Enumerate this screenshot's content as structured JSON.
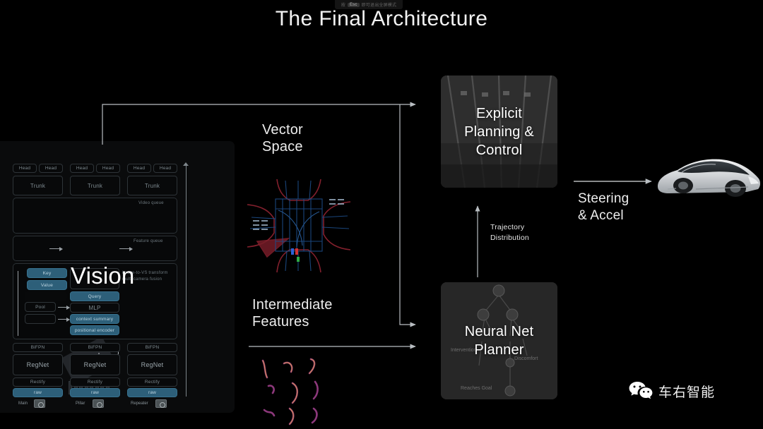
{
  "slide": {
    "title": "The Final Architecture",
    "background_color": "#000000"
  },
  "fullscreen_hint": {
    "prefix": "按",
    "key": "Esc",
    "suffix": "即可退出全屏模式"
  },
  "vision_panel": {
    "overlay_word": "Vision",
    "head_label": "Head",
    "trunk_label": "Trunk",
    "heads": [
      "Head",
      "Head",
      "Head",
      "Head",
      "Head",
      "Head"
    ],
    "trunks": [
      "Trunk",
      "Trunk",
      "Trunk"
    ],
    "video_queue_label": "Video queue",
    "feature_queue_label": "Feature queue",
    "attention": {
      "key": "Key",
      "value": "Value",
      "query": "Query",
      "mlp": "MLP",
      "pool": "Pool",
      "context_summary": "context summary",
      "positional_encoder": "positional encoder",
      "note_line1": "image-to-VS transform",
      "note_line2": "multi-camera fusion"
    },
    "backbone_rows": {
      "bifpn": [
        "BiFPN",
        "BiFPN",
        "BiFPN"
      ],
      "regnet": [
        "RegNet",
        "RegNet",
        "RegNet"
      ],
      "rectify": [
        "Rectify",
        "Rectify",
        "Rectify"
      ],
      "raw": [
        "raw",
        "raw",
        "raw"
      ]
    },
    "cameras": [
      "Main",
      "Pillar",
      "Repeater"
    ],
    "colors": {
      "blue_block": "#2d5f79",
      "panel_bg": "#0a0b0c",
      "border": "#2e3438"
    }
  },
  "outputs": {
    "vector_space_label": "Vector\nSpace",
    "vector_space_line1": "Vector",
    "vector_space_line2": "Space",
    "intermediate_features_line1": "Intermediate",
    "intermediate_features_line2": "Features"
  },
  "stages": {
    "explicit": {
      "line1": "Explicit",
      "line2": "Planning &",
      "line3": "Control"
    },
    "neural_net_planner": {
      "line1": "Neural Net",
      "line2": "Planner",
      "tree_labels": {
        "intervention": "Intervention",
        "discomfort": "Discomfort",
        "reaches_goal": "Reaches Goal"
      }
    }
  },
  "connections": {
    "trajectory_line1": "Trajectory",
    "trajectory_line2": "Distribution",
    "steering_line1": "Steering",
    "steering_line2": "& Accel"
  },
  "watermark": {
    "icon": "wechat-icon",
    "text": "车右智能"
  }
}
